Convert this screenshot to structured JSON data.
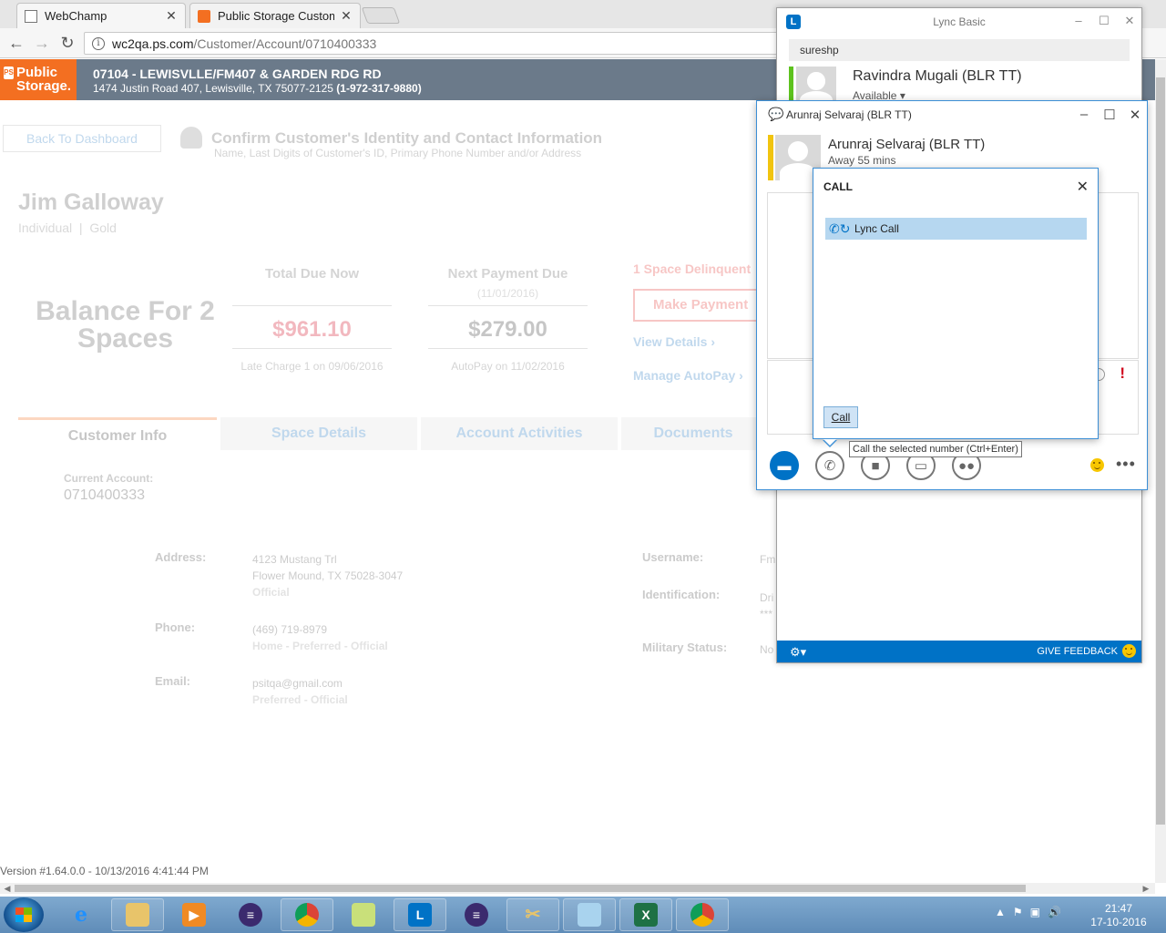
{
  "browser": {
    "tabs": [
      {
        "title": "WebChamp",
        "close": "✕"
      },
      {
        "title": "Public Storage Customer",
        "close": "✕"
      }
    ],
    "url_host": "wc2qa.ps.com",
    "url_path": "/Customer/Account/0710400333"
  },
  "header": {
    "logo_line1": "Public",
    "logo_line2": "Storage.",
    "logo_mark": "PS",
    "store_name": "07104 - LEWISVLLE/FM407 & GARDEN RDG RD",
    "store_address": "1474 Justin Road 407, Lewisville, TX 75077-2125",
    "store_phone": "(1-972-317-9880)"
  },
  "confirm": {
    "back_label": "Back To Dashboard",
    "title": "Confirm Customer's Identity and Contact Information",
    "subtitle": "Name, Last Digits of Customer's ID, Primary Phone Number and/or Address"
  },
  "customer": {
    "name": "Jim Galloway",
    "tier": "Individual  |  Gold"
  },
  "balance": {
    "title": "Balance For 2 Spaces",
    "total_due_label": "Total Due Now",
    "total_due_amount": "$961.10",
    "total_due_note": "Late Charge 1 on 09/06/2016",
    "next_due_label": "Next Payment Due",
    "next_due_date": "(11/01/2016)",
    "next_due_amount": "$279.00",
    "next_due_note": "AutoPay on 11/02/2016",
    "delinquent": "1 Space Delinquent",
    "make_payment": "Make Payment",
    "view_details": "View Details",
    "manage_autopay": "Manage AutoPay"
  },
  "page_tabs": [
    "Customer Info",
    "Space Details",
    "Account Activities",
    "Documents"
  ],
  "account": {
    "current_label": "Current Account:",
    "current_value": "0710400333"
  },
  "fields": {
    "address_label": "Address:",
    "address_line1": "4123 Mustang Trl",
    "address_line2": "Flower Mound, TX 75028-3047",
    "address_tag": "Official",
    "phone_label": "Phone:",
    "phone_value": "(469) 719-8979",
    "phone_tag": "Home - Preferred - Official",
    "email_label": "Email:",
    "email_value": "psitqa@gmail.com",
    "email_tag": "Preferred - Official",
    "username_label": "Username:",
    "username_value": "Fm",
    "identification_label": "Identification:",
    "identification_value1": "Dri",
    "identification_value2": "***",
    "military_label": "Military Status:",
    "military_value": "No"
  },
  "version": "Version #1.64.0.0 - 10/13/2016 4:41:44 PM",
  "lync_main": {
    "title": "Lync Basic",
    "search_value": "sureshp",
    "contact_name": "Ravindra Mugali (BLR TT)",
    "contact_status": "Available",
    "feedback": "GIVE FEEDBACK",
    "presence_color": "#5dc21e",
    "accent": "#0072c6"
  },
  "conversation": {
    "title": "Arunraj Selvaraj (BLR TT)",
    "contact_name": "Arunraj Selvaraj (BLR TT)",
    "contact_status": "Away 55 mins",
    "presence_color": "#f1c40f"
  },
  "call_popup": {
    "title": "CALL",
    "item_label": "Lync Call",
    "call_button": "Call",
    "tooltip": "Call the selected number (Ctrl+Enter)"
  },
  "taskbar": {
    "apps": [
      "Internet Explorer",
      "File Explorer",
      "Media Player",
      "Eclipse",
      "Chrome",
      "Sticky Notes",
      "Lync",
      "Eclipse",
      "Tools",
      "Notepad",
      "Excel",
      "Chrome"
    ],
    "time": "21:47",
    "date": "17-10-2016"
  }
}
